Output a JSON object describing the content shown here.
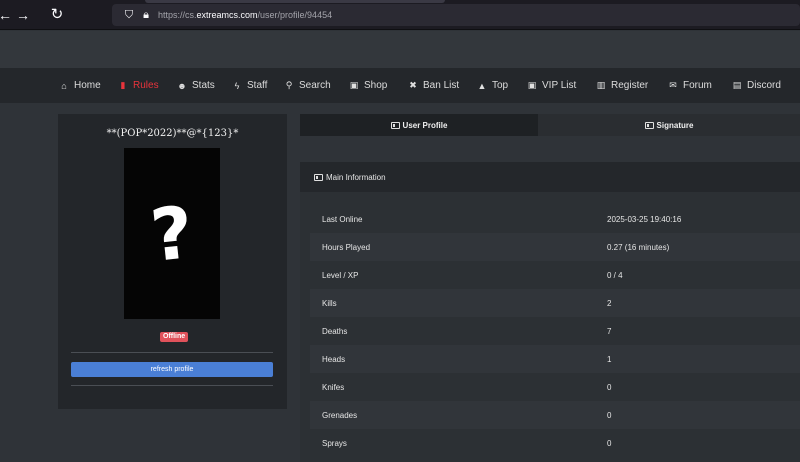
{
  "browser": {
    "url_prefix": "https://cs.",
    "url_host": "extreamcs.com",
    "url_path": "/user/profile/94454"
  },
  "nav": {
    "items": [
      {
        "label": "Home",
        "icon": "home-icon",
        "glyph": "⌂"
      },
      {
        "label": "Rules",
        "icon": "book-icon",
        "glyph": "▮"
      },
      {
        "label": "Stats",
        "icon": "users-icon",
        "glyph": "☻"
      },
      {
        "label": "Staff",
        "icon": "bolt-icon",
        "glyph": "ϟ"
      },
      {
        "label": "Search",
        "icon": "search-icon",
        "glyph": "⚲"
      },
      {
        "label": "Shop",
        "icon": "money-icon",
        "glyph": "▣"
      },
      {
        "label": "Ban List",
        "icon": "times-icon",
        "glyph": "✖"
      },
      {
        "label": "Top",
        "icon": "thumbs-up-icon",
        "glyph": "▲"
      },
      {
        "label": "VIP List",
        "icon": "id-card-icon",
        "glyph": "▣"
      },
      {
        "label": "Register",
        "icon": "chart-icon",
        "glyph": "▥"
      },
      {
        "label": "Forum",
        "icon": "envelope-icon",
        "glyph": "✉"
      },
      {
        "label": "Discord",
        "icon": "discord-icon",
        "glyph": "▤"
      }
    ],
    "active_color": "#e8343c"
  },
  "profile": {
    "player_name": "**(POP*2022)**@*{123}*",
    "status": "Offline",
    "refresh_label": "refresh profile",
    "avatar_glyph": "?"
  },
  "tabs": [
    {
      "label": "User Profile",
      "active": true
    },
    {
      "label": "Signature",
      "active": false
    }
  ],
  "main_info": {
    "header": "Main Information",
    "rows": [
      {
        "label": "Last Online",
        "value": "2025-03-25 19:40:16"
      },
      {
        "label": "Hours Played",
        "value": "0.27 (16 minutes)"
      },
      {
        "label": "Level / XP",
        "value": "0 / 4"
      },
      {
        "label": "Kills",
        "value": "2"
      },
      {
        "label": "Deaths",
        "value": "7"
      },
      {
        "label": "Heads",
        "value": "1"
      },
      {
        "label": "Knifes",
        "value": "0"
      },
      {
        "label": "Grenades",
        "value": "0"
      },
      {
        "label": "Sprays",
        "value": "0"
      }
    ]
  },
  "colors": {
    "accent_blue": "#4a7fd6",
    "badge_red": "#e0525b"
  }
}
